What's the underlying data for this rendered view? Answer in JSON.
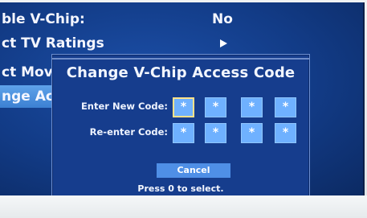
{
  "background_menu": {
    "items": [
      {
        "label": "ble V-Chip:",
        "value": "No"
      },
      {
        "label": "ct TV Ratings",
        "value": ""
      },
      {
        "label": "ct Mov",
        "value": ""
      },
      {
        "label": "nge Ac",
        "value": ""
      }
    ],
    "submenu_arrow_icon": "right-triangle-icon"
  },
  "dialog": {
    "title": "Change V-Chip Access Code",
    "new_code_label": "Enter New Code:",
    "reenter_label": "Re-enter Code:",
    "new_code_digits": [
      "*",
      "*",
      "*",
      "*"
    ],
    "reenter_digits": [
      "*",
      "*",
      "*",
      "*"
    ],
    "selected_index": 0,
    "cancel_label": "Cancel",
    "hint": "Press 0 to select."
  },
  "colors": {
    "screen_blue": "#123b86",
    "dialog_bg": "#163d8d",
    "box_fill": "#6fb1ff",
    "selected_outline": "#ffe28a",
    "cancel_button": "#4f8fe6"
  }
}
